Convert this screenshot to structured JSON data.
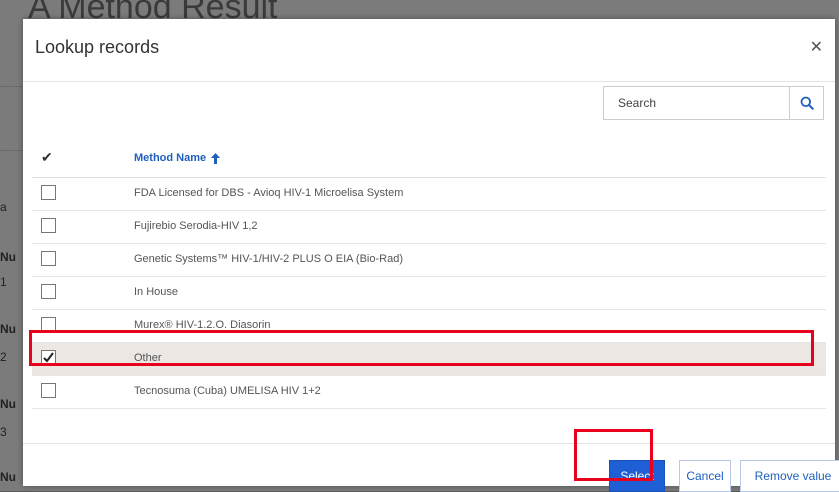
{
  "background": {
    "title": "A Method Result",
    "fragments": [
      "a",
      "Nu",
      "1",
      "Nu",
      "2",
      "Nu",
      "3",
      "Nu"
    ]
  },
  "modal": {
    "title": "Lookup records",
    "close_icon": "close-icon",
    "search": {
      "placeholder": "Search",
      "value": ""
    },
    "table": {
      "check_header": "✔",
      "column_header": "Method Name",
      "sort_icon": "arrow-up-icon",
      "rows": [
        {
          "label": "FDA Licensed for DBS - Avioq HIV-1 Microelisa System",
          "checked": false
        },
        {
          "label": "Fujirebio Serodia-HIV 1,2",
          "checked": false
        },
        {
          "label": "Genetic Systems™ HIV-1/HIV-2 PLUS O EIA (Bio-Rad)",
          "checked": false
        },
        {
          "label": "In House",
          "checked": false
        },
        {
          "label": "Murex® HIV-1.2.O. Diasorin",
          "checked": false
        },
        {
          "label": "Other",
          "checked": true
        },
        {
          "label": "Tecnosuma (Cuba) UMELISA HIV 1+2",
          "checked": false
        }
      ]
    },
    "buttons": {
      "select": "Select",
      "cancel": "Cancel",
      "remove": "Remove value"
    }
  },
  "colors": {
    "accent": "#1e5fd6",
    "highlight": "#e8001c",
    "selected_row": "#ece7e3"
  }
}
